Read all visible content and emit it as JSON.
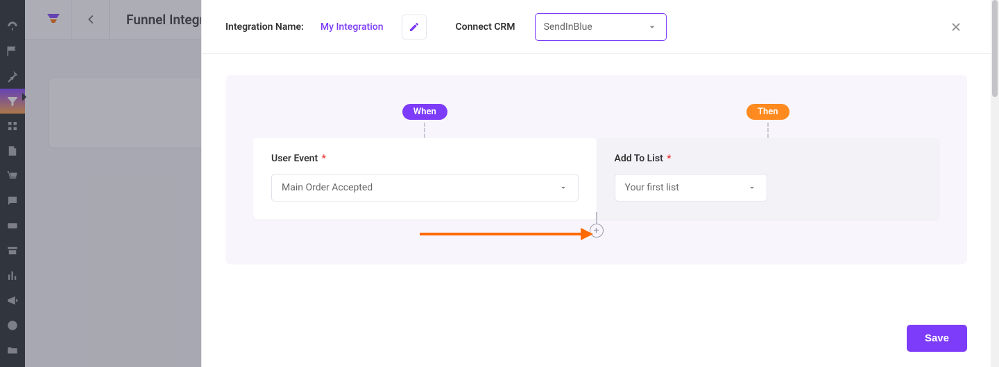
{
  "page": {
    "title": "Funnel Integrations"
  },
  "header": {
    "name_label": "Integration Name:",
    "name_value": "My Integration",
    "crm_label": "Connect CRM",
    "crm_value": "SendInBlue"
  },
  "flow": {
    "when_label": "When",
    "then_label": "Then",
    "when_card": {
      "title": "User Event",
      "value": "Main Order Accepted"
    },
    "then_card": {
      "title": "Add To List",
      "value": "Your first list"
    },
    "add_connector": "+"
  },
  "footer": {
    "save": "Save"
  },
  "req_mark": "*"
}
